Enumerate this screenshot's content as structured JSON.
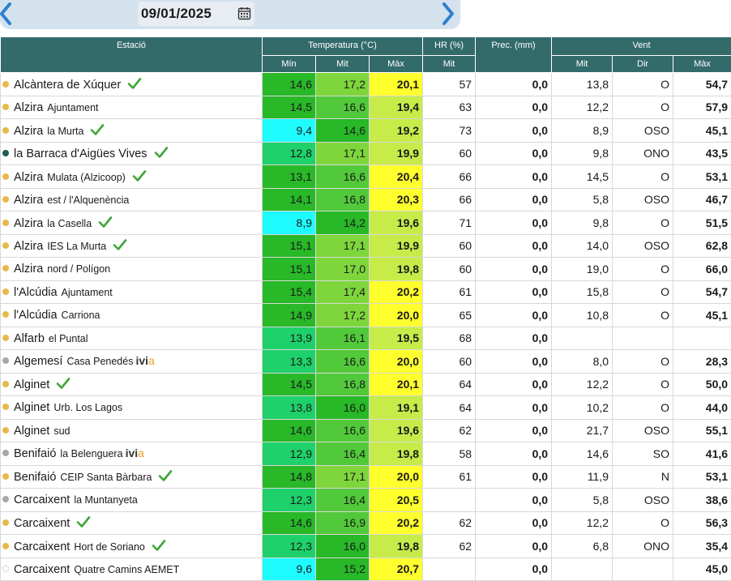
{
  "date": "09/01/2025",
  "icons": {
    "prev": "chevron-left-icon",
    "next": "chevron-right-icon",
    "calendar": "calendar-icon",
    "check": "checkmark-icon"
  },
  "colors": {
    "header": "#336b6b",
    "cyan": "#1ffcff",
    "green_dark": "#28b828",
    "green": "#52c93a",
    "green_light": "#7ed63c",
    "lime": "#c7ec4a",
    "yellow": "#ffff2e",
    "teal_green": "#1fd16a"
  },
  "headers": {
    "station": "Estació",
    "temperature": "Temperatura (°C)",
    "hr": "HR (%)",
    "prec": "Prec. (mm)",
    "wind": "Vent",
    "min": "Mín",
    "mit": "Mit",
    "max": "Màx",
    "hr_mit": "Mit",
    "wind_mit": "Mit",
    "wind_dir": "Dir",
    "wind_max": "Màx"
  },
  "rows": [
    {
      "dot": "yellow",
      "loc": "Alcàntera de Xúquer",
      "sub": "",
      "check": true,
      "ivia": false,
      "tmin": "14,6",
      "tmit": "17,2",
      "tmax": "20,1",
      "hr": "57",
      "prec": "0,0",
      "wmit": "13,8",
      "wdir": "O",
      "wmax": "54,7",
      "cmin": "#28b828",
      "cmit": "#7ed63c",
      "cmax": "#ffff2e"
    },
    {
      "dot": "yellow",
      "loc": "Alzira",
      "sub": "Ajuntament",
      "check": false,
      "ivia": false,
      "tmin": "14,5",
      "tmit": "16,6",
      "tmax": "19,4",
      "hr": "63",
      "prec": "0,0",
      "wmit": "12,2",
      "wdir": "O",
      "wmax": "57,9",
      "cmin": "#28b828",
      "cmit": "#52c93a",
      "cmax": "#c7ec4a"
    },
    {
      "dot": "yellow",
      "loc": "Alzira",
      "sub": "la Murta",
      "check": true,
      "ivia": false,
      "tmin": "9,4",
      "tmit": "14,6",
      "tmax": "19,2",
      "hr": "73",
      "prec": "0,0",
      "wmit": "8,9",
      "wdir": "OSO",
      "wmax": "45,1",
      "cmin": "#1ffcff",
      "cmit": "#28b828",
      "cmax": "#c7ec4a"
    },
    {
      "dot": "teal",
      "loc": "la Barraca d'Aigües Vives",
      "sub": "",
      "check": true,
      "ivia": false,
      "tmin": "12,8",
      "tmit": "17,1",
      "tmax": "19,9",
      "hr": "60",
      "prec": "0,0",
      "wmit": "9,8",
      "wdir": "ONO",
      "wmax": "43,5",
      "cmin": "#1fd16a",
      "cmit": "#7ed63c",
      "cmax": "#c7ec4a"
    },
    {
      "dot": "yellow",
      "loc": "Alzira",
      "sub": "Mulata (Alzicoop)",
      "check": true,
      "ivia": false,
      "tmin": "13,1",
      "tmit": "16,6",
      "tmax": "20,4",
      "hr": "66",
      "prec": "0,0",
      "wmit": "14,5",
      "wdir": "O",
      "wmax": "53,1",
      "cmin": "#28b828",
      "cmit": "#52c93a",
      "cmax": "#ffff2e"
    },
    {
      "dot": "yellow",
      "loc": "Alzira",
      "sub": "est / l'Alquenència",
      "check": false,
      "ivia": false,
      "tmin": "14,1",
      "tmit": "16,8",
      "tmax": "20,3",
      "hr": "66",
      "prec": "0,0",
      "wmit": "5,8",
      "wdir": "OSO",
      "wmax": "46,7",
      "cmin": "#28b828",
      "cmit": "#52c93a",
      "cmax": "#ffff2e"
    },
    {
      "dot": "yellow",
      "loc": "Alzira",
      "sub": "la Casella",
      "check": true,
      "ivia": false,
      "tmin": "8,9",
      "tmit": "14,2",
      "tmax": "19,6",
      "hr": "71",
      "prec": "0,0",
      "wmit": "9,8",
      "wdir": "O",
      "wmax": "51,5",
      "cmin": "#1ffcff",
      "cmit": "#28b828",
      "cmax": "#c7ec4a"
    },
    {
      "dot": "yellow",
      "loc": "Alzira",
      "sub": "IES La Murta",
      "check": true,
      "ivia": false,
      "tmin": "15,1",
      "tmit": "17,1",
      "tmax": "19,9",
      "hr": "60",
      "prec": "0,0",
      "wmit": "14,0",
      "wdir": "OSO",
      "wmax": "62,8",
      "cmin": "#28b828",
      "cmit": "#7ed63c",
      "cmax": "#c7ec4a"
    },
    {
      "dot": "yellow",
      "loc": "Alzira",
      "sub": "nord / Polígon",
      "check": false,
      "ivia": false,
      "tmin": "15,1",
      "tmit": "17,0",
      "tmax": "19,8",
      "hr": "60",
      "prec": "0,0",
      "wmit": "19,0",
      "wdir": "O",
      "wmax": "66,0",
      "cmin": "#28b828",
      "cmit": "#7ed63c",
      "cmax": "#c7ec4a"
    },
    {
      "dot": "yellow",
      "loc": "l'Alcúdia",
      "sub": "Ajuntament",
      "check": false,
      "ivia": false,
      "tmin": "15,4",
      "tmit": "17,4",
      "tmax": "20,2",
      "hr": "61",
      "prec": "0,0",
      "wmit": "15,8",
      "wdir": "O",
      "wmax": "54,7",
      "cmin": "#28b828",
      "cmit": "#7ed63c",
      "cmax": "#ffff2e"
    },
    {
      "dot": "yellow",
      "loc": "l'Alcúdia",
      "sub": "Carriona",
      "check": false,
      "ivia": false,
      "tmin": "14,9",
      "tmit": "17,2",
      "tmax": "20,0",
      "hr": "65",
      "prec": "0,0",
      "wmit": "10,8",
      "wdir": "O",
      "wmax": "45,1",
      "cmin": "#28b828",
      "cmit": "#7ed63c",
      "cmax": "#ffff2e"
    },
    {
      "dot": "yellow",
      "loc": "Alfarb",
      "sub": "el Puntal",
      "check": false,
      "ivia": false,
      "tmin": "13,9",
      "tmit": "16,1",
      "tmax": "19,5",
      "hr": "68",
      "prec": "0,0",
      "wmit": "",
      "wdir": "",
      "wmax": "",
      "cmin": "#1fd16a",
      "cmit": "#52c93a",
      "cmax": "#c7ec4a"
    },
    {
      "dot": "grey",
      "loc": "Algemesí",
      "sub": "Casa Penedés",
      "check": false,
      "ivia": true,
      "tmin": "13,3",
      "tmit": "16,6",
      "tmax": "20,0",
      "hr": "60",
      "prec": "0,0",
      "wmit": "8,0",
      "wdir": "O",
      "wmax": "28,3",
      "cmin": "#1fd16a",
      "cmit": "#52c93a",
      "cmax": "#ffff2e"
    },
    {
      "dot": "yellow",
      "loc": "Alginet",
      "sub": "",
      "check": true,
      "ivia": false,
      "tmin": "14,5",
      "tmit": "16,8",
      "tmax": "20,1",
      "hr": "64",
      "prec": "0,0",
      "wmit": "12,2",
      "wdir": "O",
      "wmax": "50,0",
      "cmin": "#28b828",
      "cmit": "#52c93a",
      "cmax": "#ffff2e"
    },
    {
      "dot": "yellow",
      "loc": "Alginet",
      "sub": "Urb. Los Lagos",
      "check": false,
      "ivia": false,
      "tmin": "13,8",
      "tmit": "16,0",
      "tmax": "19,1",
      "hr": "64",
      "prec": "0,0",
      "wmit": "10,2",
      "wdir": "O",
      "wmax": "44,0",
      "cmin": "#1fd16a",
      "cmit": "#28b828",
      "cmax": "#c7ec4a"
    },
    {
      "dot": "yellow",
      "loc": "Alginet",
      "sub": "sud",
      "check": false,
      "ivia": false,
      "tmin": "14,6",
      "tmit": "16,6",
      "tmax": "19,6",
      "hr": "62",
      "prec": "0,0",
      "wmit": "21,7",
      "wdir": "OSO",
      "wmax": "55,1",
      "cmin": "#28b828",
      "cmit": "#52c93a",
      "cmax": "#c7ec4a"
    },
    {
      "dot": "grey",
      "loc": "Benifaió",
      "sub": "la Belenguera",
      "check": false,
      "ivia": true,
      "tmin": "12,9",
      "tmit": "16,4",
      "tmax": "19,8",
      "hr": "58",
      "prec": "0,0",
      "wmit": "14,6",
      "wdir": "SO",
      "wmax": "41,6",
      "cmin": "#1fd16a",
      "cmit": "#52c93a",
      "cmax": "#c7ec4a"
    },
    {
      "dot": "yellow",
      "loc": "Benifaió",
      "sub": "CEIP Santa Bàrbara",
      "check": true,
      "ivia": false,
      "tmin": "14,8",
      "tmit": "17,1",
      "tmax": "20,0",
      "hr": "61",
      "prec": "0,0",
      "wmit": "11,9",
      "wdir": "N",
      "wmax": "53,1",
      "cmin": "#28b828",
      "cmit": "#7ed63c",
      "cmax": "#ffff2e"
    },
    {
      "dot": "grey",
      "loc": "Carcaixent",
      "sub": "la Muntanyeta",
      "check": false,
      "ivia": false,
      "tmin": "12,3",
      "tmit": "16,4",
      "tmax": "20,5",
      "hr": "",
      "prec": "0,0",
      "wmit": "5,8",
      "wdir": "OSO",
      "wmax": "38,6",
      "cmin": "#1fd16a",
      "cmit": "#52c93a",
      "cmax": "#ffff2e"
    },
    {
      "dot": "yellow",
      "loc": "Carcaixent",
      "sub": "",
      "check": true,
      "ivia": false,
      "tmin": "14,6",
      "tmit": "16,9",
      "tmax": "20,2",
      "hr": "62",
      "prec": "0,0",
      "wmit": "12,2",
      "wdir": "O",
      "wmax": "56,3",
      "cmin": "#28b828",
      "cmit": "#52c93a",
      "cmax": "#ffff2e"
    },
    {
      "dot": "yellow",
      "loc": "Carcaixent",
      "sub": "Hort de Soriano",
      "check": true,
      "ivia": false,
      "tmin": "12,3",
      "tmit": "16,0",
      "tmax": "19,8",
      "hr": "62",
      "prec": "0,0",
      "wmit": "6,8",
      "wdir": "ONO",
      "wmax": "35,4",
      "cmin": "#1fd16a",
      "cmit": "#28b828",
      "cmax": "#c7ec4a"
    },
    {
      "dot": "empty",
      "loc": "Carcaixent",
      "sub": "Quatre Camins AEMET",
      "check": false,
      "ivia": false,
      "tmin": "9,6",
      "tmit": "15,2",
      "tmax": "20,7",
      "hr": "",
      "prec": "0,0",
      "wmit": "",
      "wdir": "",
      "wmax": "45,0",
      "cmin": "#1ffcff",
      "cmit": "#28b828",
      "cmax": "#ffff2e"
    }
  ]
}
